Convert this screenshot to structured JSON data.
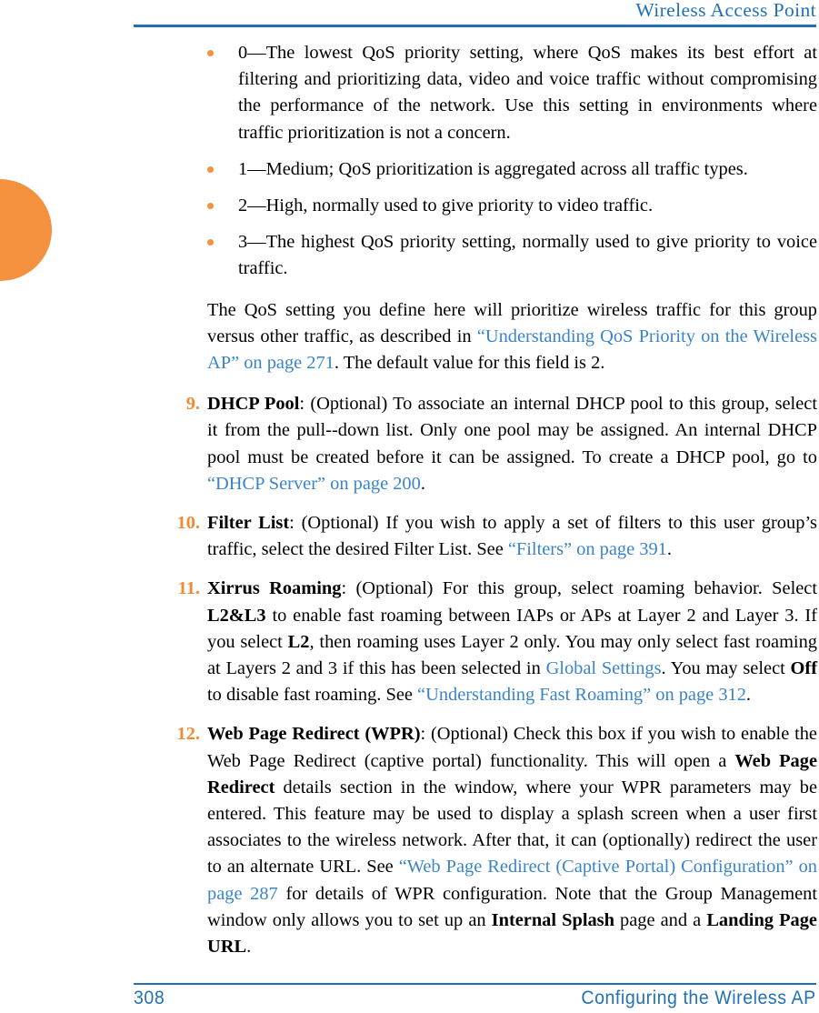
{
  "header": {
    "title": "Wireless Access Point"
  },
  "footer": {
    "page_number": "308",
    "section": "Configuring the Wireless AP"
  },
  "colors": {
    "accent_blue": "#2171b5",
    "link_blue": "#3a84c8",
    "accent_orange": "#f4913e",
    "number_orange": "#f08a33",
    "body_text": "#000000",
    "page_background": "#ffffff"
  },
  "content": {
    "qos_bullets": [
      {
        "marker": "bullet",
        "text": "0—The lowest QoS priority setting, where QoS makes its best effort at filtering and prioritizing data, video and voice traffic without compromising the performance of the network. Use this setting in environments where traffic prioritization is not a concern."
      },
      {
        "marker": "bullet",
        "text": "1—Medium; QoS prioritization is aggregated across all traffic types."
      },
      {
        "marker": "bullet",
        "text": "2—High, normally used to give priority to video traffic."
      },
      {
        "marker": "bullet",
        "text": "3—The highest QoS priority setting, normally used to give priority to voice traffic."
      }
    ],
    "qos_paragraph": {
      "lead": "The QoS setting you define here will prioritize wireless traffic for this group versus other traffic, as described in ",
      "link": "“Understanding QoS Priority on the Wireless AP” on page 271",
      "tail": ". The default value for this field is 2."
    },
    "steps": [
      {
        "number": "9.",
        "term": "DHCP Pool",
        "body_1": ": (Optional) To associate an internal DHCP pool to this group, select it from the pull--down list. Only one pool may be assigned. An internal DHCP pool must be created before it can be assigned. To create a DHCP pool, go to ",
        "link_1": "“DHCP Server” on page 200",
        "body_2": "."
      },
      {
        "number": "10.",
        "term": "Filter List",
        "body_1": ": (Optional) If you wish to apply a set of filters to this user group’s traffic, select the desired Filter List. See ",
        "link_1": "“Filters” on page 391",
        "body_2": "."
      },
      {
        "number": "11.",
        "term": "Xirrus Roaming",
        "body_1": ": (Optional) For this group, select roaming behavior. Select ",
        "bold_1": "L2&L3",
        "body_2": " to enable fast roaming between IAPs or APs at Layer 2 and Layer 3. If you select ",
        "bold_2": "L2",
        "body_3": ", then roaming uses Layer 2 only. You may only select fast roaming at Layers 2 and 3 if this has been selected in ",
        "link_1": "Global Settings",
        "body_4": ". You may select ",
        "bold_3": "Off",
        "body_5": " to disable fast roaming. See ",
        "link_2": "“Understanding Fast Roaming” on page 312",
        "body_6": "."
      },
      {
        "number": "12.",
        "term": "Web Page Redirect (WPR)",
        "body_1": ": (Optional) Check this box if you wish to enable the Web Page Redirect (captive portal) functionality. This will open a ",
        "bold_1": "Web Page Redirect",
        "body_2": " details section in the window, where your WPR parameters may be entered. This feature may be used to display a splash screen when a user first associates to the wireless network. After that, it can (optionally) redirect the user to an alternate URL. See ",
        "link_1": "“Web Page Redirect (Captive Portal) Configuration” on page 287",
        "body_3": " for details of WPR configuration. Note that the Group Management window only allows you to set up an ",
        "bold_2": "Internal Splash",
        "body_4": " page and a ",
        "bold_3": "Landing Page URL",
        "body_5": "."
      }
    ]
  }
}
